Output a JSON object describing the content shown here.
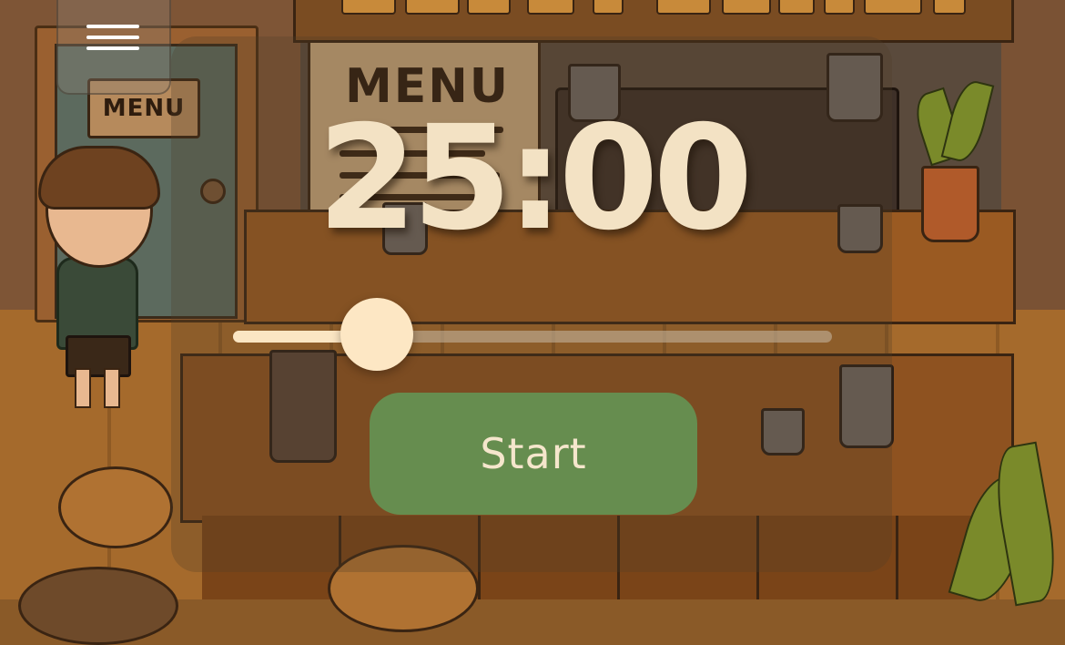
{
  "scene": {
    "menu_sign": "MENU",
    "menu_board_title": "MENU"
  },
  "nav": {
    "menu_icon": "hamburger-icon"
  },
  "timer": {
    "display": "25:00"
  },
  "duration_slider": {
    "level_fraction": 0.24
  },
  "controls": {
    "start_label": "Start"
  },
  "colors": {
    "timer_text": "#f3e2c4",
    "slider_thumb": "#fde7c4",
    "start_button": "#60a05c"
  }
}
